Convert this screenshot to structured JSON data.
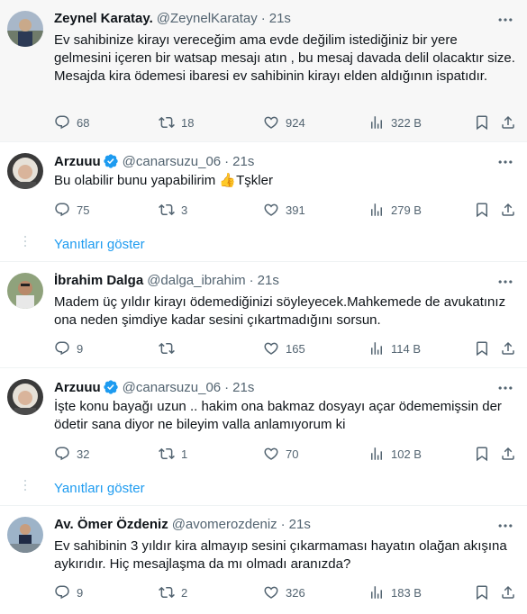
{
  "tweets": [
    {
      "name": "Zeynel Karatay.",
      "handle": "@ZeynelKaratay",
      "time": "21s",
      "text": "Ev sahibinize kirayı vereceğim ama evde değilim istediğiniz bir yere gelmesini içeren bir watsap mesajı atın , bu mesaj davada delil olacaktır size. Mesajda kira ödemesi ibaresi ev sahibinin kirayı elden aldığının ispatıdır.",
      "replies": "68",
      "retweets": "18",
      "likes": "924",
      "views": "322 B"
    },
    {
      "name": "Arzuuu",
      "handle": "@canarsuzu_06",
      "time": "21s",
      "text": "Bu olabilir bunu yapabilirim 👍Tşkler",
      "replies": "75",
      "retweets": "3",
      "likes": "391",
      "views": "279 B"
    },
    {
      "name": "İbrahim Dalga",
      "handle": "@dalga_ibrahim",
      "time": "21s",
      "text": "Madem üç yıldır kirayı ödemediğinizi söyleyecek.Mahkemede de avukatınız ona neden şimdiye kadar sesini çıkartmadığını sorsun.",
      "replies": "9",
      "retweets": "",
      "likes": "165",
      "views": "114 B"
    },
    {
      "name": "Arzuuu",
      "handle": "@canarsuzu_06",
      "time": "21s",
      "text": "İşte konu bayağı uzun .. hakim ona bakmaz dosyayı açar ödememişsin der ödetir sana diyor ne bileyim valla anlamıyorum ki",
      "replies": "32",
      "retweets": "1",
      "likes": "70",
      "views": "102 B"
    },
    {
      "name": "Av. Ömer Özdeniz",
      "handle": "@avomerozdeniz",
      "time": "21s",
      "text": "Ev sahibinin 3 yıldır kira almayıp sesini çıkarmaması hayatın olağan akışına aykırıdır. Hiç mesajlaşma da mı olmadı aranızda?",
      "replies": "9",
      "retweets": "2",
      "likes": "326",
      "views": "183 B"
    }
  ],
  "show_replies": "Yanıtları göster",
  "icons": [
    "reply-icon",
    "retweet-icon",
    "like-icon",
    "views-icon",
    "bookmark-icon",
    "share-icon",
    "more-icon",
    "verified-badge-icon"
  ],
  "colors": {
    "accent": "#1d9bf0",
    "muted": "#536471",
    "highlight_bg": "#f7f7f7",
    "thumbs": "#f4b93e"
  }
}
